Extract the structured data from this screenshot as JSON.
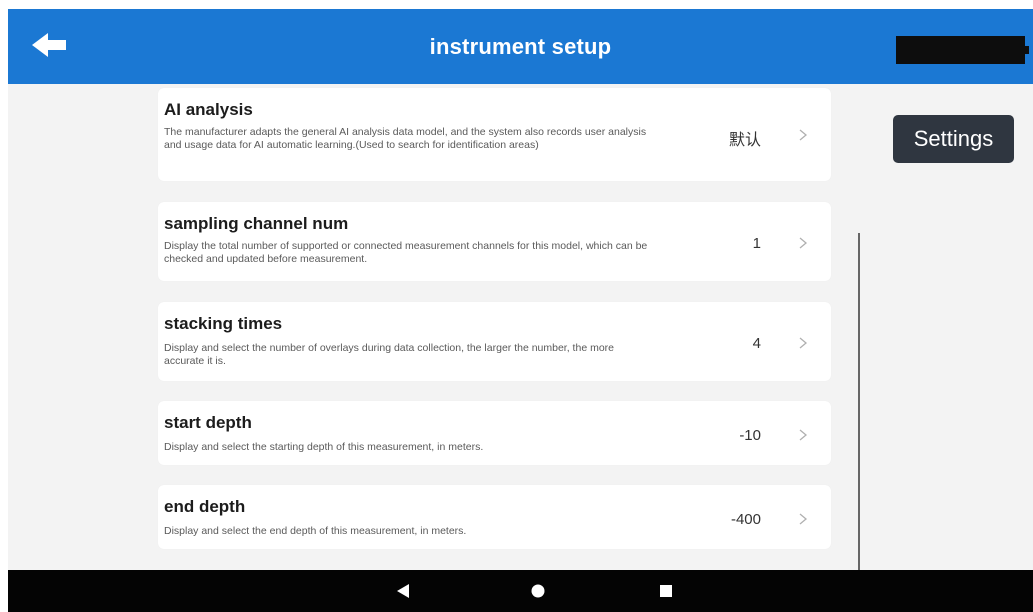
{
  "appbar": {
    "title": "instrument setup",
    "back_icon": "arrow-left-icon",
    "color": "#1b78d3"
  },
  "settings_button": {
    "label": "Settings"
  },
  "rows": [
    {
      "title": "AI analysis",
      "description": "The manufacturer adapts the general AI analysis data model, and the system also records user analysis and usage data for AI automatic learning.(Used to search for identification areas)",
      "value": "默认"
    },
    {
      "title": "sampling channel num",
      "description": "Display the total number of supported or connected measurement channels for this model, which can be checked and updated before measurement.",
      "value": "1"
    },
    {
      "title": "stacking times",
      "description": "Display and select the number of overlays during data collection, the larger the number, the more accurate it is.",
      "value": "4"
    },
    {
      "title": "start depth",
      "description": "Display and select the starting depth of this measurement, in meters.",
      "value": "-10"
    },
    {
      "title": "end depth",
      "description": "Display and select the end depth of this measurement, in meters.",
      "value": "-400"
    }
  ],
  "navbar": {
    "icons": [
      "nav-back-icon",
      "nav-home-icon",
      "nav-recent-icon"
    ]
  }
}
